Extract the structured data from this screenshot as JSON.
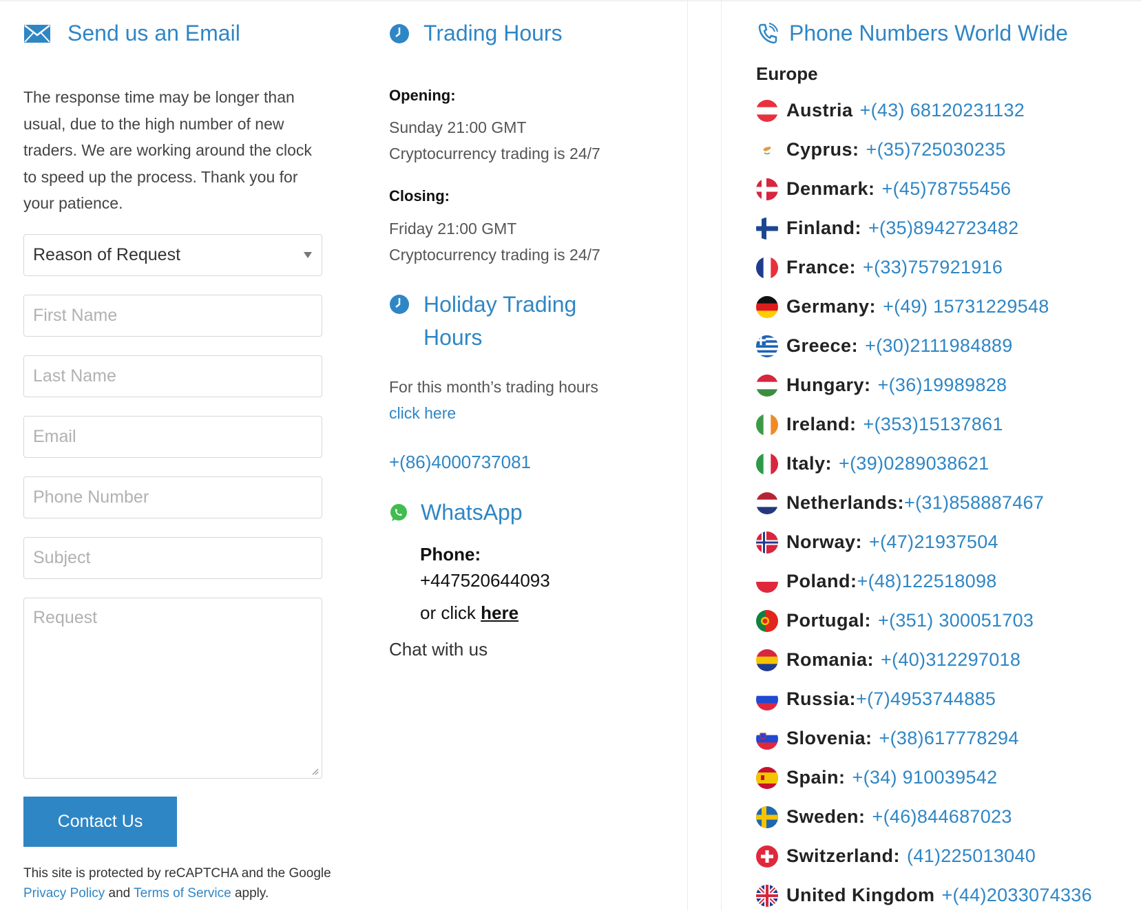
{
  "email_section": {
    "title": "Send us an Email",
    "intro": "The response time may be longer than usual, due to the high number of new traders. We are working around the clock to speed up the process. Thank you for your patience.",
    "reason_select": "Reason of Request",
    "first_name_placeholder": "First Name",
    "last_name_placeholder": "Last Name",
    "email_placeholder": "Email",
    "phone_placeholder": "Phone Number",
    "subject_placeholder": "Subject",
    "request_placeholder": "Request",
    "submit_label": "Contact Us",
    "recaptcha_text_1": "This site is protected by reCAPTCHA and the Google",
    "privacy_link": "Privacy Policy",
    "recaptcha_and": "and",
    "terms_link": "Terms of Service",
    "recaptcha_apply": "apply."
  },
  "trading_hours": {
    "title": "Trading Hours",
    "opening_label": "Opening:",
    "opening_time": "Sunday 21:00 GMT",
    "opening_crypto": "Cryptocurrency trading is 24/7",
    "closing_label": "Closing:",
    "closing_time": "Friday 21:00 GMT",
    "closing_crypto": "Cryptocurrency trading is 24/7"
  },
  "holiday_hours": {
    "title_line1": "Holiday Trading",
    "title_line2": "Hours",
    "text": "For this month’s trading hours",
    "link": "click here",
    "phone": "+(86)4000737081"
  },
  "whatsapp": {
    "title": "WhatsApp",
    "phone_label": "Phone:",
    "phone_number": "+447520644093",
    "or_click": "or click ",
    "here_link": "here",
    "chat": "Chat with us"
  },
  "phone_numbers": {
    "title": "Phone Numbers World Wide",
    "region": "Europe",
    "countries": [
      {
        "name": "Austria",
        "phone": "+(43) 68120231132",
        "flag": "austria-flag-icon"
      },
      {
        "name": "Cyprus:",
        "phone": "+(35)725030235",
        "flag": "cyprus-flag-icon"
      },
      {
        "name": "Denmark:",
        "phone": "+(45)78755456",
        "flag": "denmark-flag-icon"
      },
      {
        "name": "Finland:",
        "phone": "+(35)8942723482",
        "flag": "finland-flag-icon"
      },
      {
        "name": "France:",
        "phone": "+(33)757921916",
        "flag": "france-flag-icon"
      },
      {
        "name": "Germany:",
        "phone": "+(49) 15731229548",
        "flag": "germany-flag-icon"
      },
      {
        "name": "Greece:",
        "phone": "+(30)2111984889",
        "flag": "greece-flag-icon"
      },
      {
        "name": "Hungary:",
        "phone": "+(36)19989828",
        "flag": "hungary-flag-icon"
      },
      {
        "name": "Ireland:",
        "phone": "+(353)15137861",
        "flag": "ireland-flag-icon"
      },
      {
        "name": "Italy:",
        "phone": "+(39)0289038621",
        "flag": "italy-flag-icon"
      },
      {
        "name": "Netherlands:",
        "phone": "+(31)858887467",
        "flag": "netherlands-flag-icon"
      },
      {
        "name": "Norway:",
        "phone": "+(47)21937504",
        "flag": "norway-flag-icon"
      },
      {
        "name": "Poland:",
        "phone": "+(48)122518098",
        "flag": "poland-flag-icon"
      },
      {
        "name": "Portugal:",
        "phone": "+(351) 300051703",
        "flag": "portugal-flag-icon"
      },
      {
        "name": "Romania:",
        "phone": "+(40)312297018",
        "flag": "romania-flag-icon"
      },
      {
        "name": "Russia:",
        "phone": "+(7)4953744885",
        "flag": "russia-flag-icon"
      },
      {
        "name": "Slovenia:",
        "phone": "+(38)617778294",
        "flag": "slovenia-flag-icon"
      },
      {
        "name": "Spain:",
        "phone": "+(34) 910039542",
        "flag": "spain-flag-icon"
      },
      {
        "name": "Sweden:",
        "phone": "+(46)844687023",
        "flag": "sweden-flag-icon"
      },
      {
        "name": "Switzerland:",
        "phone": "(41)225013040",
        "flag": "switzerland-flag-icon"
      },
      {
        "name": "United Kingdom",
        "phone": "+(44)2033074336",
        "flag": "united-kingdom-flag-icon"
      }
    ]
  },
  "colors": {
    "accent": "#2f86c5",
    "text": "#333333",
    "placeholder": "#b1b1b1"
  }
}
